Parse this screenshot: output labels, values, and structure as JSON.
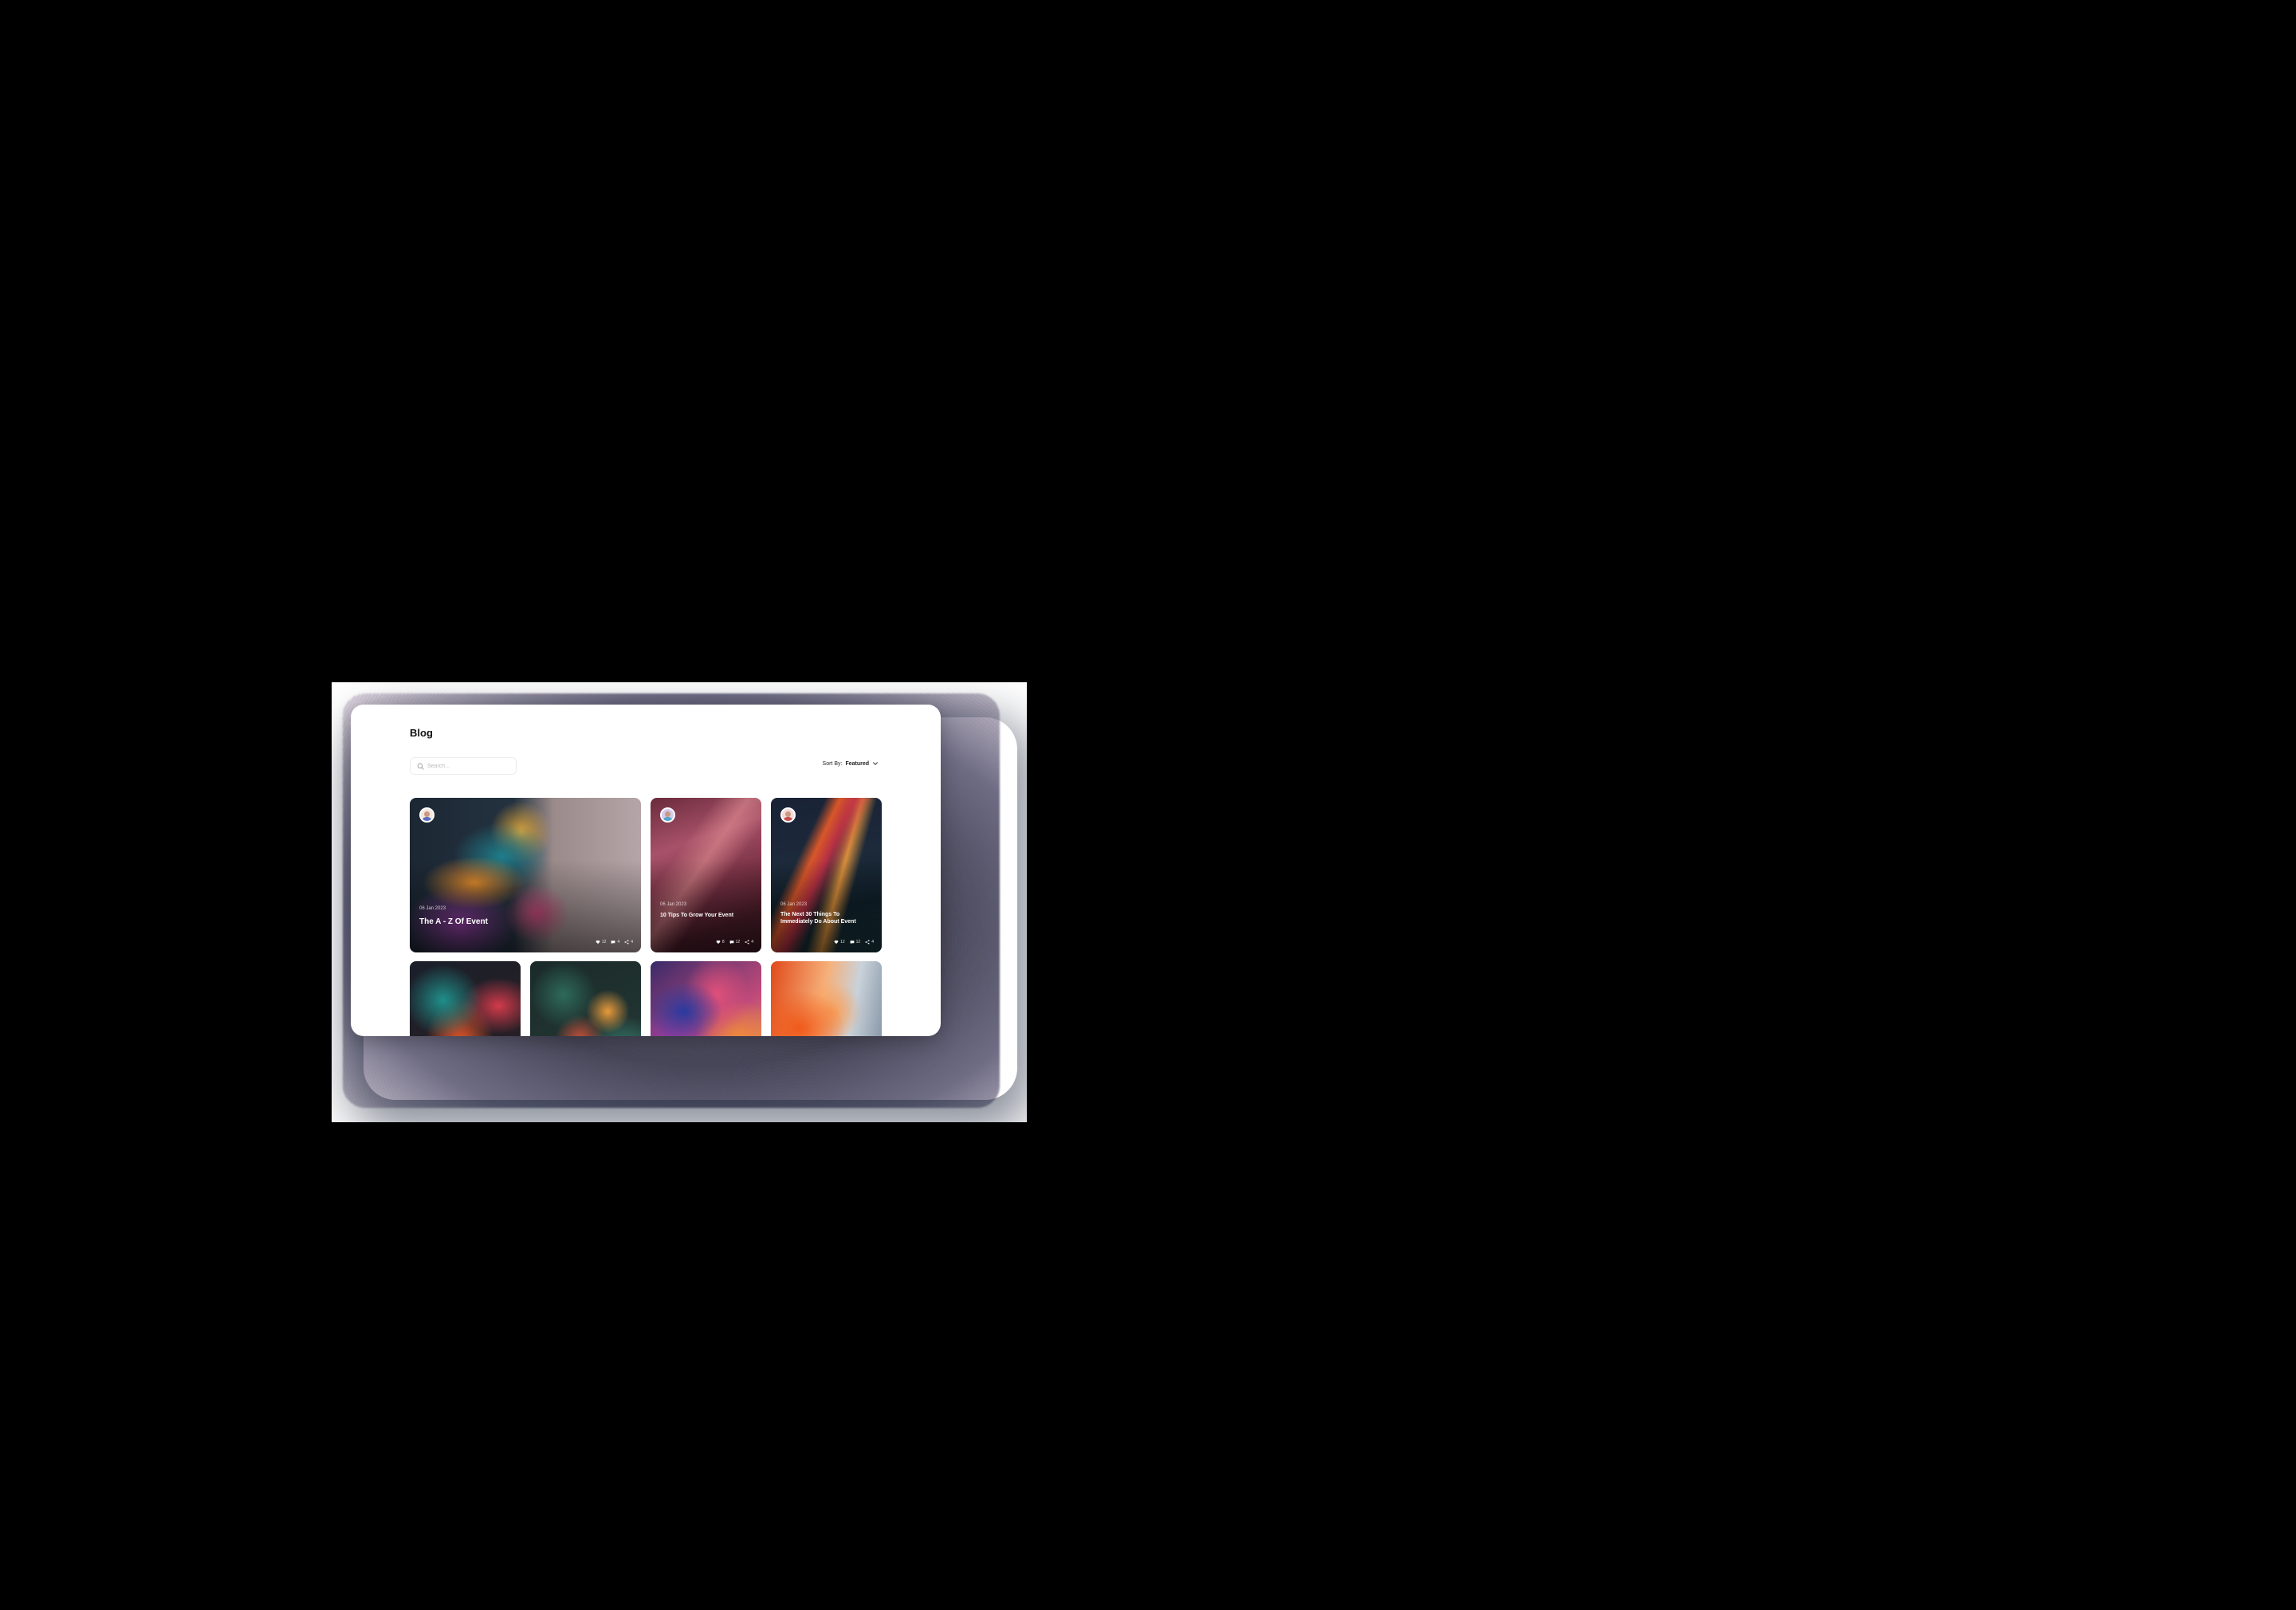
{
  "page": {
    "title": "Blog"
  },
  "search": {
    "placeholder": "Search..."
  },
  "sort": {
    "label": "Sort By:",
    "value": "Featured"
  },
  "featured_cards": [
    {
      "date": "06 Jan 2023",
      "title": "The A - Z Of Event",
      "stats": {
        "likes": "12",
        "comments": "4",
        "shares": "4"
      }
    },
    {
      "date": "06 Jan 2023",
      "title": "10 Tips To Grow Your Event",
      "stats": {
        "likes": "8",
        "comments": "12",
        "shares": "4"
      }
    },
    {
      "date": "06 Jan 2023",
      "title": "The Next 30 Things To Immediately Do About Event",
      "stats": {
        "likes": "12",
        "comments": "12",
        "shares": "4"
      }
    }
  ],
  "colors": {
    "page_background": "#000000",
    "window_background": "#ffffff",
    "title_text": "#111111",
    "card_text": "#ffffff"
  },
  "icons": {
    "search": "search-icon",
    "sort_chevron": "chevron-down-icon",
    "likes": "heart-icon",
    "comments": "comment-icon",
    "shares": "share-icon"
  }
}
